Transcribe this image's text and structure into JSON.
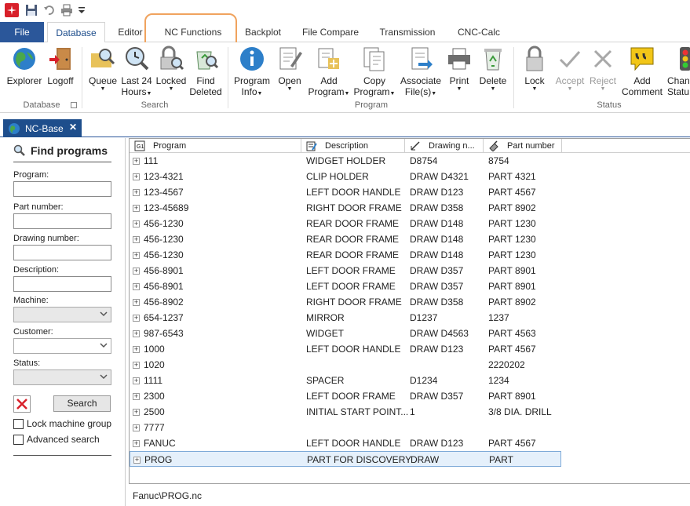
{
  "quick_access": {
    "icons": [
      "app-logo-icon",
      "save-icon",
      "undo-icon",
      "print-icon",
      "customize-icon"
    ]
  },
  "tabs": {
    "file": "File",
    "items": [
      {
        "label": "Database"
      },
      {
        "label": "Editor"
      },
      {
        "label": "NC Functions"
      },
      {
        "label": "Backplot"
      },
      {
        "label": "File Compare"
      },
      {
        "label": "Transmission"
      },
      {
        "label": "CNC-Calc"
      }
    ]
  },
  "ribbon": {
    "explorer": "Explorer",
    "logoff": "Logoff",
    "queue": "Queue",
    "last24": "Last 24",
    "last24b": "Hours",
    "locked": "Locked",
    "find_deleted_a": "Find",
    "find_deleted_b": "Deleted",
    "program_info_a": "Program",
    "program_info_b": "Info",
    "open": "Open",
    "add_program_a": "Add",
    "add_program_b": "Program",
    "copy_program_a": "Copy",
    "copy_program_b": "Program",
    "associate_a": "Associate",
    "associate_b": "File(s)",
    "print": "Print",
    "delete": "Delete",
    "lock": "Lock",
    "accept": "Accept",
    "reject": "Reject",
    "add_comment_a": "Add",
    "add_comment_b": "Comment",
    "change_status_a": "Chan",
    "change_status_b": "Statu",
    "group_database": "Database",
    "group_search": "Search",
    "group_program": "Program",
    "group_status": "Status"
  },
  "doc_tab": {
    "label": "NC-Base"
  },
  "find_panel": {
    "title": "Find programs",
    "program_label": "Program:",
    "program_value": "",
    "part_label": "Part number:",
    "part_value": "",
    "drawing_label": "Drawing number:",
    "drawing_value": "",
    "description_label": "Description:",
    "description_value": "",
    "machine_label": "Machine:",
    "machine_value": "",
    "customer_label": "Customer:",
    "customer_value": "",
    "status_label": "Status:",
    "status_value": "",
    "search_button": "Search",
    "lock_group": "Lock machine group",
    "advanced": "Advanced search"
  },
  "grid": {
    "columns": [
      "Program",
      "Description",
      "Drawing n...",
      "Part number"
    ],
    "rows": [
      {
        "program": "111",
        "description": "WIDGET HOLDER",
        "drawing": "D8754",
        "part": "8754"
      },
      {
        "program": "123-4321",
        "description": "CLIP HOLDER",
        "drawing": "DRAW D4321",
        "part": "PART 4321"
      },
      {
        "program": "123-4567",
        "description": "LEFT DOOR HANDLE",
        "drawing": "DRAW D123",
        "part": "PART 4567"
      },
      {
        "program": "123-45689",
        "description": "RIGHT DOOR FRAME",
        "drawing": "DRAW D358",
        "part": "PART 8902"
      },
      {
        "program": "456-1230",
        "description": "REAR DOOR FRAME",
        "drawing": "DRAW D148",
        "part": "PART 1230"
      },
      {
        "program": "456-1230",
        "description": "REAR DOOR FRAME",
        "drawing": "DRAW D148",
        "part": "PART 1230"
      },
      {
        "program": "456-1230",
        "description": "REAR DOOR FRAME",
        "drawing": "DRAW D148",
        "part": "PART 1230"
      },
      {
        "program": "456-8901",
        "description": "LEFT DOOR FRAME",
        "drawing": "DRAW D357",
        "part": "PART 8901"
      },
      {
        "program": "456-8901",
        "description": "LEFT DOOR FRAME",
        "drawing": "DRAW D357",
        "part": "PART 8901"
      },
      {
        "program": "456-8902",
        "description": "RIGHT DOOR FRAME",
        "drawing": "DRAW D358",
        "part": "PART 8902"
      },
      {
        "program": "654-1237",
        "description": "MIRROR",
        "drawing": "D1237",
        "part": "1237"
      },
      {
        "program": "987-6543",
        "description": "WIDGET",
        "drawing": "DRAW D4563",
        "part": "PART 4563"
      },
      {
        "program": "1000",
        "description": "LEFT DOOR HANDLE",
        "drawing": "DRAW D123",
        "part": "PART 4567"
      },
      {
        "program": "1020",
        "description": "",
        "drawing": "",
        "part": "2220202"
      },
      {
        "program": "1111",
        "description": "SPACER",
        "drawing": "D1234",
        "part": "1234"
      },
      {
        "program": "2300",
        "description": "LEFT DOOR FRAME",
        "drawing": "DRAW D357",
        "part": "PART 8901"
      },
      {
        "program": "2500",
        "description": "INITIAL START POINT...",
        "drawing": "1",
        "part": "3/8 DIA. DRILL"
      },
      {
        "program": "7777",
        "description": "",
        "drawing": "",
        "part": ""
      },
      {
        "program": "FANUC",
        "description": "LEFT DOOR HANDLE",
        "drawing": "DRAW D123",
        "part": "PART 4567"
      },
      {
        "program": "PROG",
        "description": "PART FOR DISCOVERY",
        "drawing": "DRAW",
        "part": "PART"
      }
    ]
  },
  "status_bar": {
    "path": "Fanuc\\PROG.nc"
  }
}
